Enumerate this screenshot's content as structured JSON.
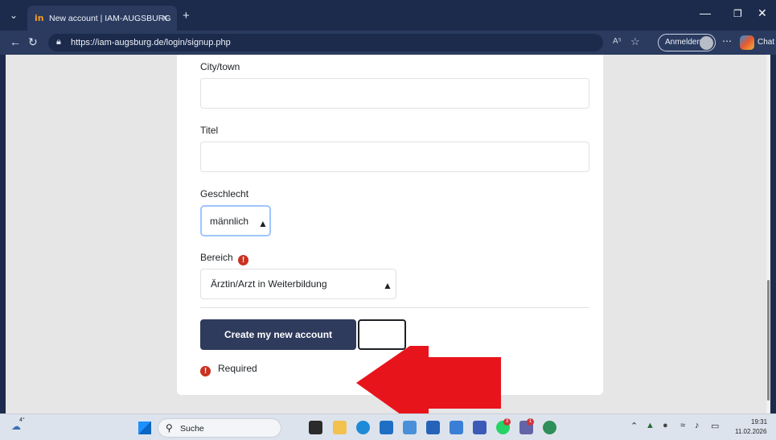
{
  "browser": {
    "tab_menu_icon": "chevron-down-icon",
    "tab_favicon": "in",
    "tab_title": "New account | IAM-AUGSBURG",
    "tab_close": "×",
    "new_tab": "+",
    "url": "https://iam-augsburg.de/login/signup.php",
    "signin_label": "Anmelden",
    "chat_label": "Chat",
    "read_aloud": "A⁵"
  },
  "form": {
    "city_label": "City/town",
    "city_value": "",
    "title_label": "Titel",
    "title_value": "",
    "gender_label": "Geschlecht",
    "gender_value": "männlich",
    "area_label": "Bereich",
    "area_value": "Ärztin/Arzt in Weiterbildung",
    "required_marker": "!",
    "submit_label": "Create my new account",
    "cancel_label": "",
    "required_note": "Required"
  },
  "annotation": {
    "arrow_color": "#e8141c",
    "arrow_direction": "left"
  },
  "taskbar": {
    "weather_temp": "4°",
    "search_placeholder": "Suche",
    "time": "19:31",
    "date": "11.02.2026",
    "whatsapp_badge": "3",
    "teams_badge": "1"
  },
  "colors": {
    "primary_button": "#2f3b5d",
    "required_icon": "#ca3120",
    "browser_chrome": "#1c2b4c"
  }
}
